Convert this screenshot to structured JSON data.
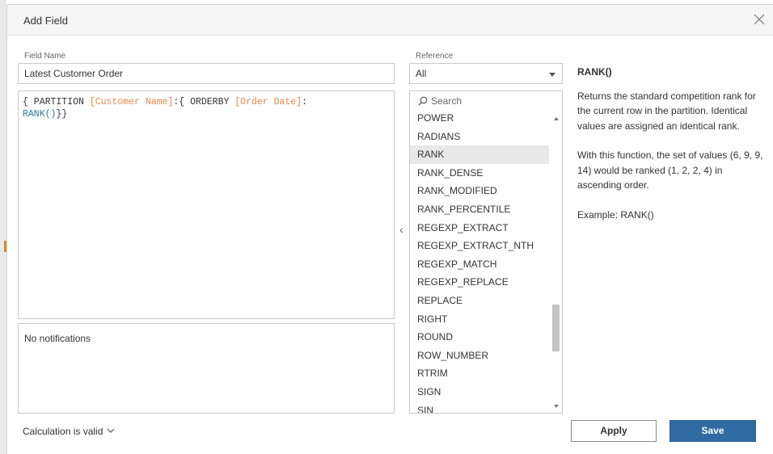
{
  "dialog": {
    "title": "Add Field"
  },
  "field_name": {
    "label": "Field Name",
    "value": "Latest Customer Order"
  },
  "formula": {
    "t1": "{ PARTITION ",
    "t2": "[Customer Name]",
    "t3": ":{ ORDERBY ",
    "t4": "[Order Date]",
    "t5": ":",
    "t6": "RANK()",
    "t7": "}}"
  },
  "notifications": {
    "text": "No notifications"
  },
  "status": {
    "text": "Calculation is valid",
    "chevron": "⌄"
  },
  "reference": {
    "label": "Reference",
    "selected": "All",
    "search_placeholder": "Search",
    "items": [
      "POWER",
      "RADIANS",
      "RANK",
      "RANK_DENSE",
      "RANK_MODIFIED",
      "RANK_PERCENTILE",
      "REGEXP_EXTRACT",
      "REGEXP_EXTRACT_NTH",
      "REGEXP_MATCH",
      "REGEXP_REPLACE",
      "REPLACE",
      "RIGHT",
      "ROUND",
      "ROW_NUMBER",
      "RTRIM",
      "SIGN",
      "SIN"
    ],
    "selected_item": "RANK",
    "collapse_glyph": "‹"
  },
  "help": {
    "title": "RANK()",
    "description": "Returns the standard competition rank for the current row in the partition. Identical values are assigned an identical rank.",
    "detail": "With this function, the set of values (6, 9, 9, 14) would be ranked (1, 2, 2, 4) in ascending order.",
    "example": "Example: RANK()"
  },
  "buttons": {
    "apply": "Apply",
    "save": "Save"
  },
  "colors": {
    "reference_token": "#e8884e",
    "function_token": "#2f7aa0",
    "save_bg": "#2f6aa3"
  }
}
